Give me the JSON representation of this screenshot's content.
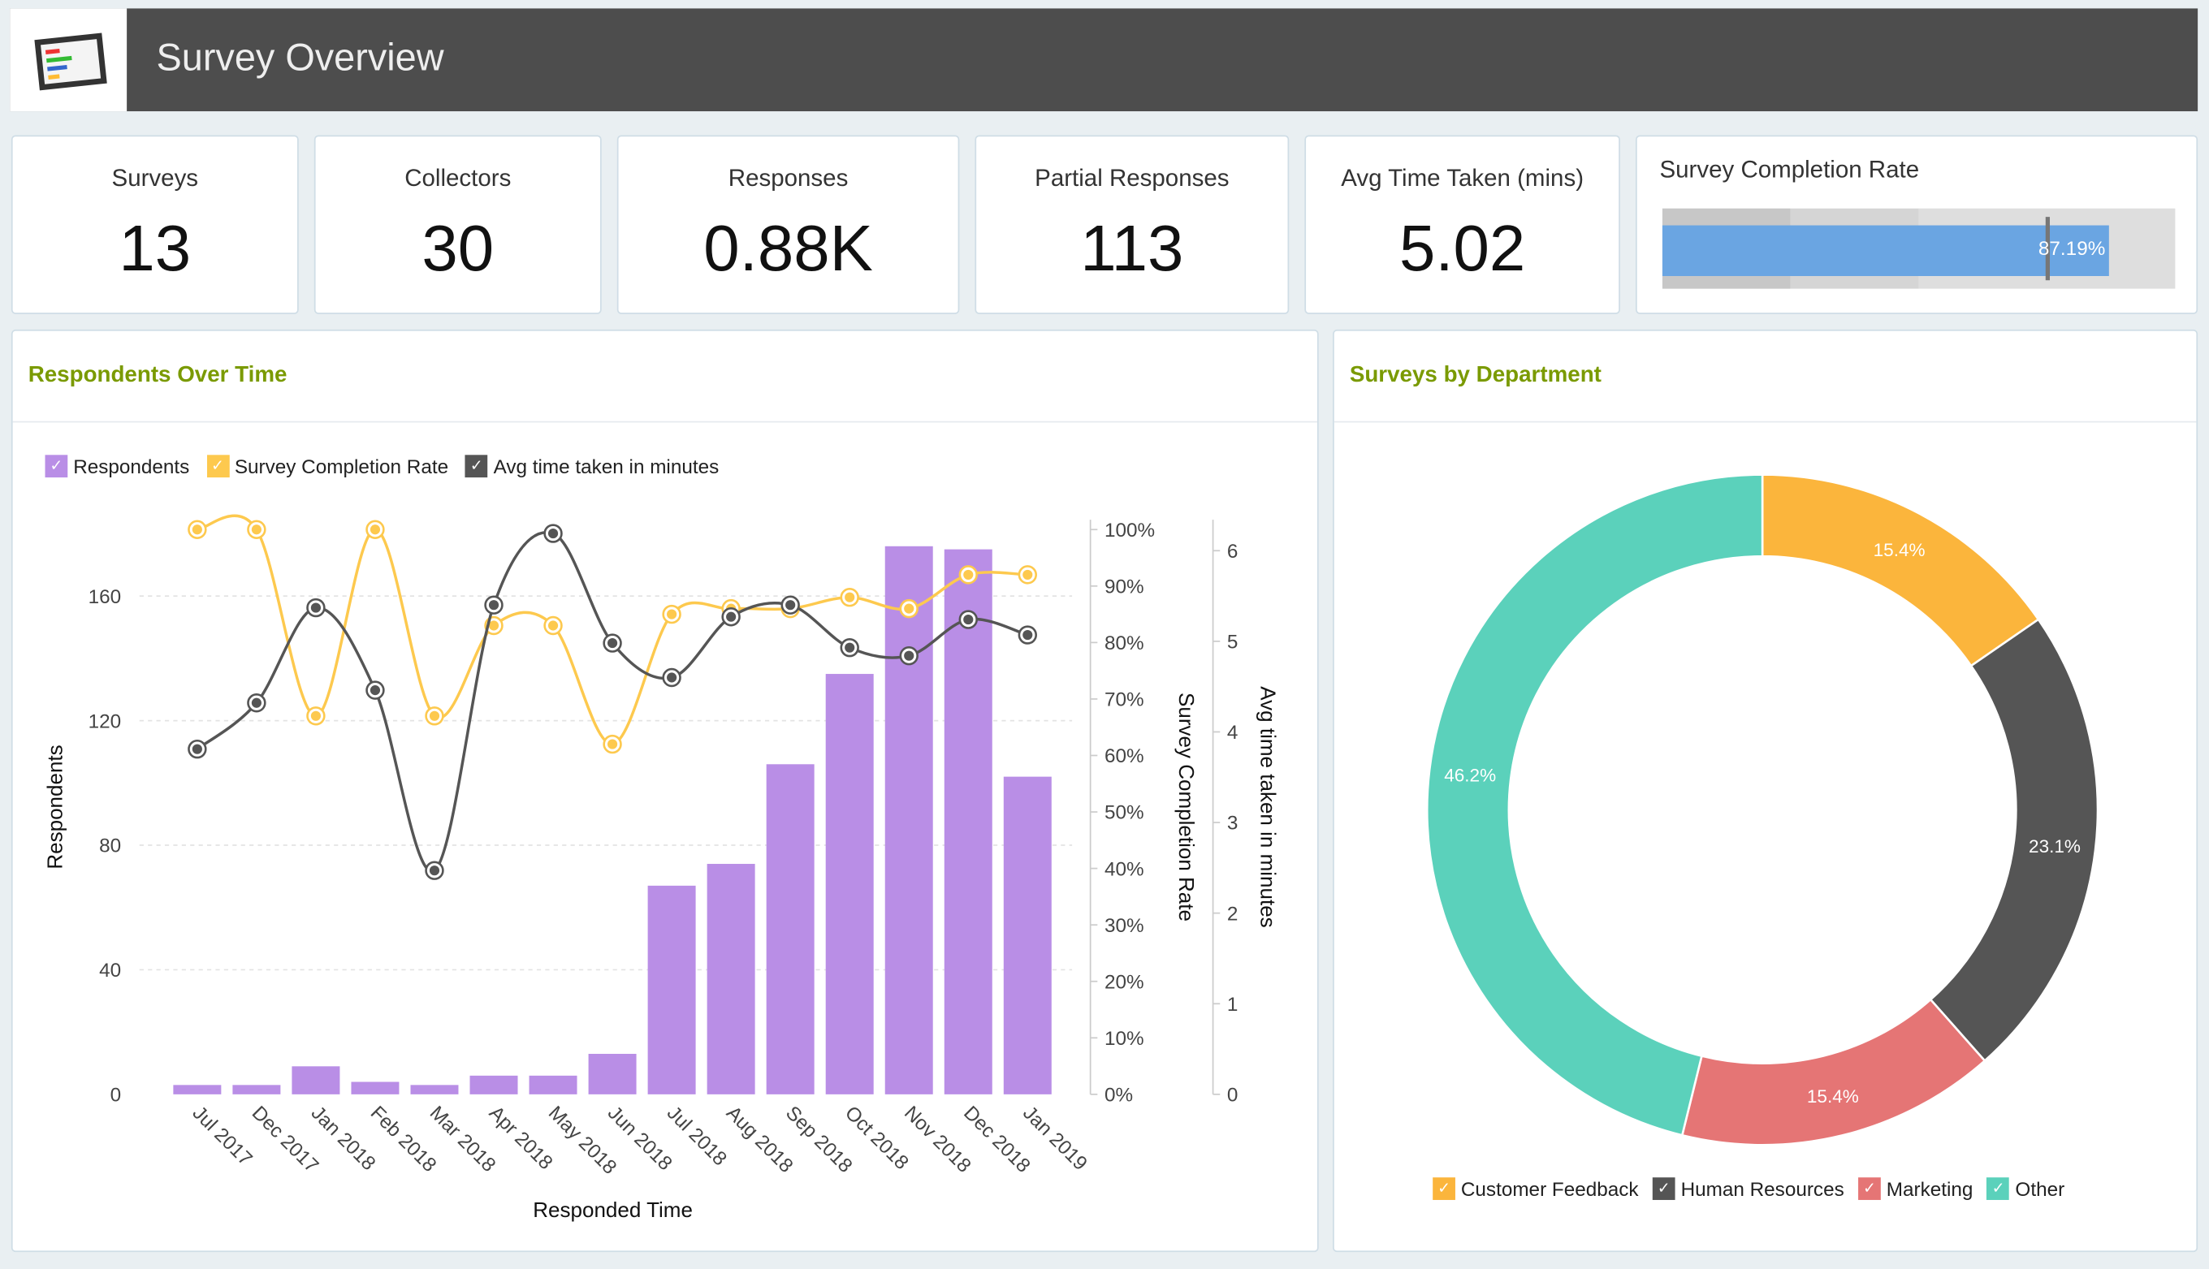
{
  "header": {
    "title": "Survey Overview",
    "logo_icon": "dashboard-monitor-icon"
  },
  "kpis": [
    {
      "label": "Surveys",
      "value": "13"
    },
    {
      "label": "Collectors",
      "value": "30"
    },
    {
      "label": "Responses",
      "value": "0.88K"
    },
    {
      "label": "Partial Responses",
      "value": "113"
    },
    {
      "label": "Avg Time Taken (mins)",
      "value": "5.02"
    }
  ],
  "completion": {
    "label": "Survey Completion Rate",
    "value_text": "87.19%",
    "value": 87.19,
    "target": 75,
    "range": [
      0,
      100
    ],
    "bands": [
      25,
      50,
      100
    ],
    "color": "#6aa5e2"
  },
  "respondents_panel": {
    "title": "Respondents Over Time"
  },
  "donut_panel": {
    "title": "Surveys by Department"
  },
  "chart_data": [
    {
      "type": "bar+line",
      "title": "Respondents Over Time",
      "categories": [
        "Jul 2017",
        "Dec 2017",
        "Jan 2018",
        "Feb 2018",
        "Mar 2018",
        "Apr 2018",
        "May 2018",
        "Jun 2018",
        "Jul 2018",
        "Aug 2018",
        "Sep 2018",
        "Oct 2018",
        "Nov 2018",
        "Dec 2018",
        "Jan 2019"
      ],
      "xlabel": "Responded Time",
      "ylabel": "Respondents",
      "y2label": "Survey Completion Rate",
      "y3label": "Avg time taken in minutes",
      "y_ticks": [
        "0",
        "40",
        "80",
        "120",
        "160"
      ],
      "y2_ticks": [
        "0%",
        "10%",
        "20%",
        "30%",
        "40%",
        "50%",
        "60%",
        "70%",
        "80%",
        "90%",
        "100%"
      ],
      "y3_ticks": [
        "0",
        "1",
        "2",
        "3",
        "4",
        "5",
        "6"
      ],
      "ylim": [
        0,
        180
      ],
      "y2lim": [
        0,
        100
      ],
      "y3lim": [
        0,
        6.2
      ],
      "grid": true,
      "legend": "top-left",
      "series": [
        {
          "name": "Respondents",
          "type": "bar",
          "axis": "y",
          "color": "#b98ee6",
          "values": [
            3,
            3,
            9,
            4,
            3,
            6,
            6,
            13,
            67,
            74,
            106,
            135,
            176,
            175,
            102
          ]
        },
        {
          "name": "Survey Completion Rate",
          "type": "line",
          "axis": "y2",
          "color": "#fdc94e",
          "values": [
            100,
            100,
            67,
            100,
            67,
            83,
            83,
            62,
            85,
            86,
            86,
            88,
            86,
            92,
            92
          ]
        },
        {
          "name": "Avg time taken in minutes",
          "type": "line",
          "axis": "y3",
          "color": "#555555",
          "values": [
            3.81,
            4.32,
            5.37,
            4.46,
            2.47,
            5.4,
            6.19,
            4.98,
            4.6,
            5.27,
            5.4,
            4.93,
            4.84,
            5.24,
            5.07
          ]
        }
      ]
    },
    {
      "type": "pie",
      "title": "Surveys by Department",
      "legend": "bottom",
      "slices": [
        {
          "label": "Customer Feedback",
          "value": 15.4,
          "text": "15.4%",
          "color": "#fbb53c"
        },
        {
          "label": "Human Resources",
          "value": 23.1,
          "text": "23.1%",
          "color": "#555555"
        },
        {
          "label": "Marketing",
          "value": 15.4,
          "text": "15.4%",
          "color": "#e57575"
        },
        {
          "label": "Other",
          "value": 46.2,
          "text": "46.2%",
          "color": "#5bd1bb"
        }
      ]
    }
  ]
}
